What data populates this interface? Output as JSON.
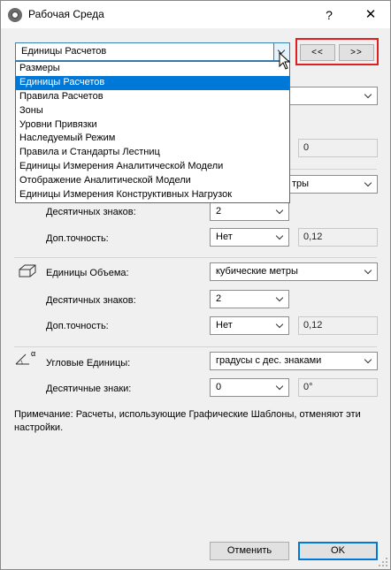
{
  "window": {
    "title": "Рабочая Среда",
    "help": "?",
    "close": "✕"
  },
  "category_select": {
    "value": "Единицы Расчетов",
    "options": [
      "Размеры",
      "Единицы Расчетов",
      "Правила Расчетов",
      "Зоны",
      "Уровни Привязки",
      "Наследуемый Режим",
      "Правила и Стандарты Лестниц",
      "Единицы Измерения Аналитической Модели",
      "Отображение Аналитической Модели",
      "Единицы Измерения Конструктивных Нагрузок"
    ],
    "selected_index": 1
  },
  "nav": {
    "prev": "<<",
    "next": ">>"
  },
  "hidden_rows": {
    "partial_value_1": "0",
    "partial_select_suffix": "тры"
  },
  "area": {
    "decimals_label": "Десятичных знаков:",
    "decimals_value": "2",
    "extra_label": "Доп.точность:",
    "extra_value": "Нет",
    "extra_result": "0,12"
  },
  "volume": {
    "label": "Единицы Объема:",
    "unit": "кубические метры",
    "decimals_label": "Десятичных знаков:",
    "decimals_value": "2",
    "extra_label": "Доп.точность:",
    "extra_value": "Нет",
    "extra_result": "0,12"
  },
  "angle": {
    "label": "Угловые Единицы:",
    "unit": "градусы с дес. знаками",
    "decimals_label": "Десятичные знаки:",
    "decimals_value": "0",
    "result": "0°",
    "icon_symbol": "α"
  },
  "note": "Примечание: Расчеты, использующие Графические Шаблоны, отменяют эти настройки.",
  "buttons": {
    "cancel": "Отменить",
    "ok": "OK"
  },
  "colors": {
    "selection": "#0078d7",
    "highlight_frame": "#e02020"
  }
}
